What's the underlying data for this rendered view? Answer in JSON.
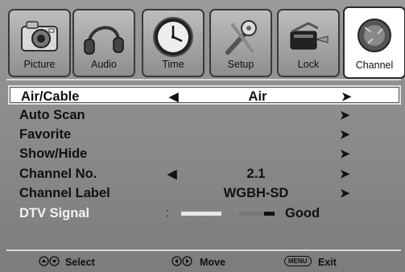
{
  "tabs": [
    {
      "label": "Picture",
      "icon": "camera-icon"
    },
    {
      "label": "Audio",
      "icon": "headphones-icon"
    },
    {
      "label": "Time",
      "icon": "clock-icon"
    },
    {
      "label": "Setup",
      "icon": "tools-icon"
    },
    {
      "label": "Lock",
      "icon": "lock-icon"
    },
    {
      "label": "Channel",
      "icon": "satellite-dish-icon",
      "active": true
    }
  ],
  "menu": {
    "air_cable": {
      "label": "Air/Cable",
      "value": "Air"
    },
    "auto_scan": {
      "label": "Auto Scan"
    },
    "favorite": {
      "label": "Favorite"
    },
    "show_hide": {
      "label": "Show/Hide"
    },
    "channel_no": {
      "label": "Channel No.",
      "value": "2.1"
    },
    "channel_label": {
      "label": "Channel Label",
      "value": "WGBH-SD"
    },
    "dtv_signal": {
      "label": "DTV Signal",
      "colon": ":",
      "value": "Good",
      "level": 0.75
    }
  },
  "footer": {
    "select": "Select",
    "move": "Move",
    "menu_key": "MENU",
    "exit": "Exit"
  },
  "colors": {
    "background": "#8a8a8a",
    "highlight": "#ffffff",
    "signal_low": "#e8e8e8",
    "signal_mid": "#777777",
    "signal_high": "#111111"
  }
}
